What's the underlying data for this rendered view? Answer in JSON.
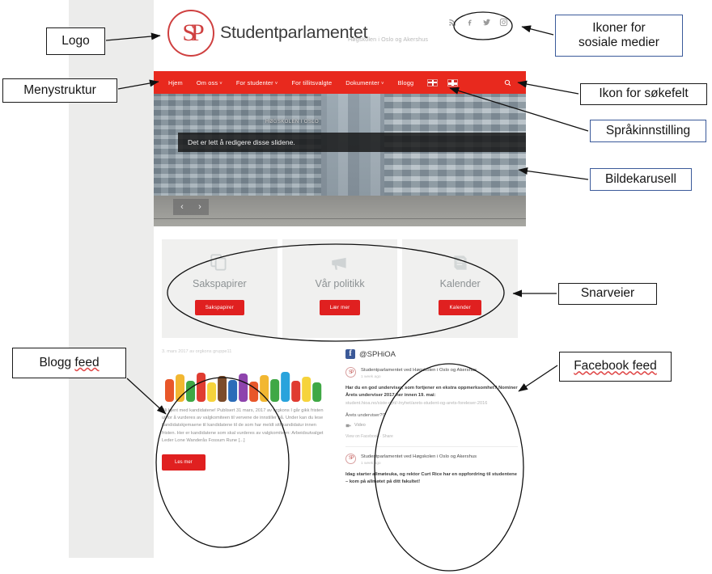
{
  "site": {
    "logo_alt": "SP",
    "title": "Studentparlamentet",
    "tagline": "Høgskolen i Oslo og Akershus",
    "social_icons": [
      "rss-icon",
      "facebook-icon",
      "twitter-icon",
      "instagram-icon"
    ],
    "nav": [
      {
        "label": "Hjem",
        "caret": ""
      },
      {
        "label": "Om oss",
        "caret": "˅"
      },
      {
        "label": "For studenter",
        "caret": "˅"
      },
      {
        "label": "For tillitsvalgte",
        "caret": ""
      },
      {
        "label": "Dokumenter",
        "caret": "˅"
      },
      {
        "label": "Blogg",
        "caret": ""
      }
    ],
    "languages": [
      "english-flag",
      "norwegian-flag"
    ],
    "search_icon": "search-icon",
    "carousel": {
      "caption": "Det er lett å redigere disse slidene.",
      "sign_text": "HØGSKOLEN I OSLO",
      "prev": "‹",
      "next": "›"
    },
    "cards": [
      {
        "icon": "documents-icon",
        "title": "Sakspapirer",
        "button": "Sakspapirer"
      },
      {
        "icon": "megaphone-icon",
        "title": "Vår politikk",
        "button": "Lær mer"
      },
      {
        "icon": "book-icon",
        "title": "Kalender",
        "button": "Kalender"
      }
    ],
    "blog": {
      "meta": "3. mars 2017 av orgkons gruppe11",
      "image_alt": "fargede hender",
      "excerpt": "Bli kjent med kandidatene! Publisert 31 mars, 2017 av orgkons I går gikk fristen ut for å vurderes av valgkomiteen til vervene de innstiller på. Under kan du lese kandidatskjemaene til kandidatene til de som har meldt sitt kandidatur innen fristen. Her er kandidatene som skal vurderes av valgkomiteen: Arbeidsutvalget Leder Lone Wanderås Fossum Rune [...]",
      "button": "Les mer"
    },
    "facebook": {
      "handle": "@SPHiOA",
      "posts": [
        {
          "author": "Studentparlamentet ved Høgskolen i Oslo og Akershus",
          "time": "1 week ago",
          "body": "Har du en god underviser, som fortjener en ekstra oppmerksomhet? Nominer Årets underviser 2017 her innen 19. mai:",
          "link": "student.hioa.no/siste-nytt/-/nyhet/arets-student-og-arets-foreleser-2016",
          "sub": "Årets underviser?!?",
          "video_label": "Video",
          "actions": "View on Facebook · Share"
        },
        {
          "author": "Studentparlamentet ved Høgskolen i Oslo og Akershus",
          "time": "1 week ago",
          "body": "Idag starter allmøteuka, og rektor Curt Rice har en oppfordring til studentene – kom på allmøtet på ditt fakultet!",
          "link": "",
          "sub": "",
          "video_label": "",
          "actions": ""
        }
      ]
    }
  },
  "annotations": [
    {
      "id": "logo",
      "text": "Logo",
      "border": "black"
    },
    {
      "id": "menystruktur",
      "text": "Menystruktur",
      "border": "black"
    },
    {
      "id": "sosiale",
      "line1": "Ikoner for",
      "line2": "sosiale medier",
      "border": "blue"
    },
    {
      "id": "sokefelt",
      "text": "Ikon for søkefelt",
      "border": "black"
    },
    {
      "id": "sprak",
      "text": "Språkinnstilling",
      "border": "blue"
    },
    {
      "id": "bildekarusell",
      "text": "Bildekarusell",
      "border": "blue"
    },
    {
      "id": "snarveier",
      "text": "Snarveier",
      "border": "black"
    },
    {
      "id": "blogg-feed",
      "text_plain": "Blogg ",
      "text_spell": "feed",
      "border": "black"
    },
    {
      "id": "facebook-feed",
      "text_spell_all": "Facebook feed",
      "border": "black"
    }
  ],
  "colors": {
    "brand_red": "#e8291e",
    "button_red": "#e02020",
    "logo_red": "#cf4040",
    "backdrop_grey": "#ececeb",
    "anno_blue_border": "#3b5a9a",
    "anno_black_border": "#1a1a1a",
    "spell_underline": "#e04848"
  }
}
